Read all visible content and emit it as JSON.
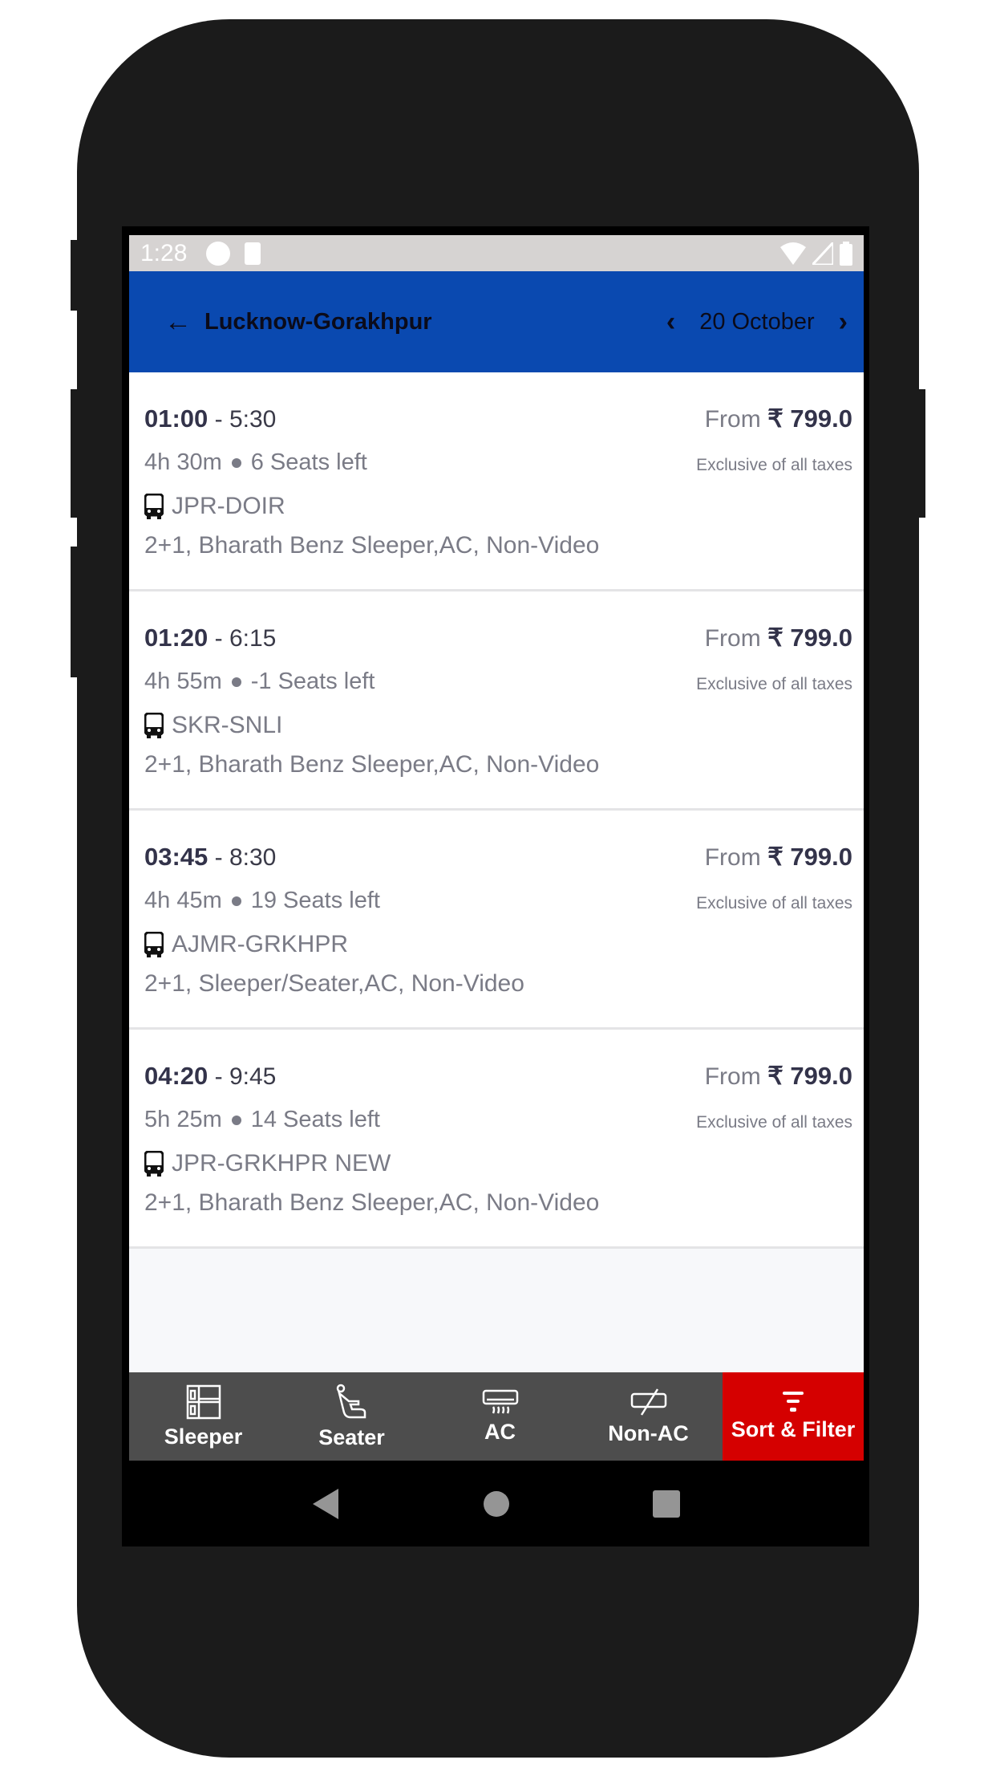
{
  "status_bar": {
    "time": "1:28"
  },
  "header": {
    "title": "Lucknow-Gorakhpur",
    "date": "20 October"
  },
  "colors": {
    "header": "#0a49b0",
    "active_tab": "#d50000",
    "tab_bar": "#4d4d4d"
  },
  "trips": [
    {
      "depart": "01:00",
      "arrive": "5:30",
      "duration": "4h 30m",
      "seats": "6 Seats left",
      "route": "JPR-DOIR",
      "bus_type": "2+1, Bharath Benz Sleeper,AC, Non-Video",
      "from_label": "From",
      "price": "₹ 799.0",
      "tax_note": "Exclusive of all taxes"
    },
    {
      "depart": "01:20",
      "arrive": "6:15",
      "duration": "4h 55m",
      "seats": "-1 Seats left",
      "route": "SKR-SNLI",
      "bus_type": "2+1, Bharath Benz Sleeper,AC, Non-Video",
      "from_label": "From",
      "price": "₹ 799.0",
      "tax_note": "Exclusive of all taxes"
    },
    {
      "depart": "03:45",
      "arrive": "8:30",
      "duration": "4h 45m",
      "seats": "19 Seats left",
      "route": "AJMR-GRKHPR",
      "bus_type": "2+1, Sleeper/Seater,AC, Non-Video",
      "from_label": "From",
      "price": "₹ 799.0",
      "tax_note": "Exclusive of all taxes"
    },
    {
      "depart": "04:20",
      "arrive": "9:45",
      "duration": "5h 25m",
      "seats": "14 Seats left",
      "route": "JPR-GRKHPR NEW",
      "bus_type": "2+1, Bharath Benz Sleeper,AC, Non-Video",
      "from_label": "From",
      "price": "₹ 799.0",
      "tax_note": "Exclusive of all taxes"
    }
  ],
  "tabs": [
    {
      "label": "Sleeper",
      "icon": "sleeper-icon"
    },
    {
      "label": "Seater",
      "icon": "seat-icon"
    },
    {
      "label": "AC",
      "icon": "ac-icon"
    },
    {
      "label": "Non-AC",
      "icon": "non-ac-icon"
    },
    {
      "label": "Sort & Filter",
      "icon": "filter-icon"
    }
  ]
}
